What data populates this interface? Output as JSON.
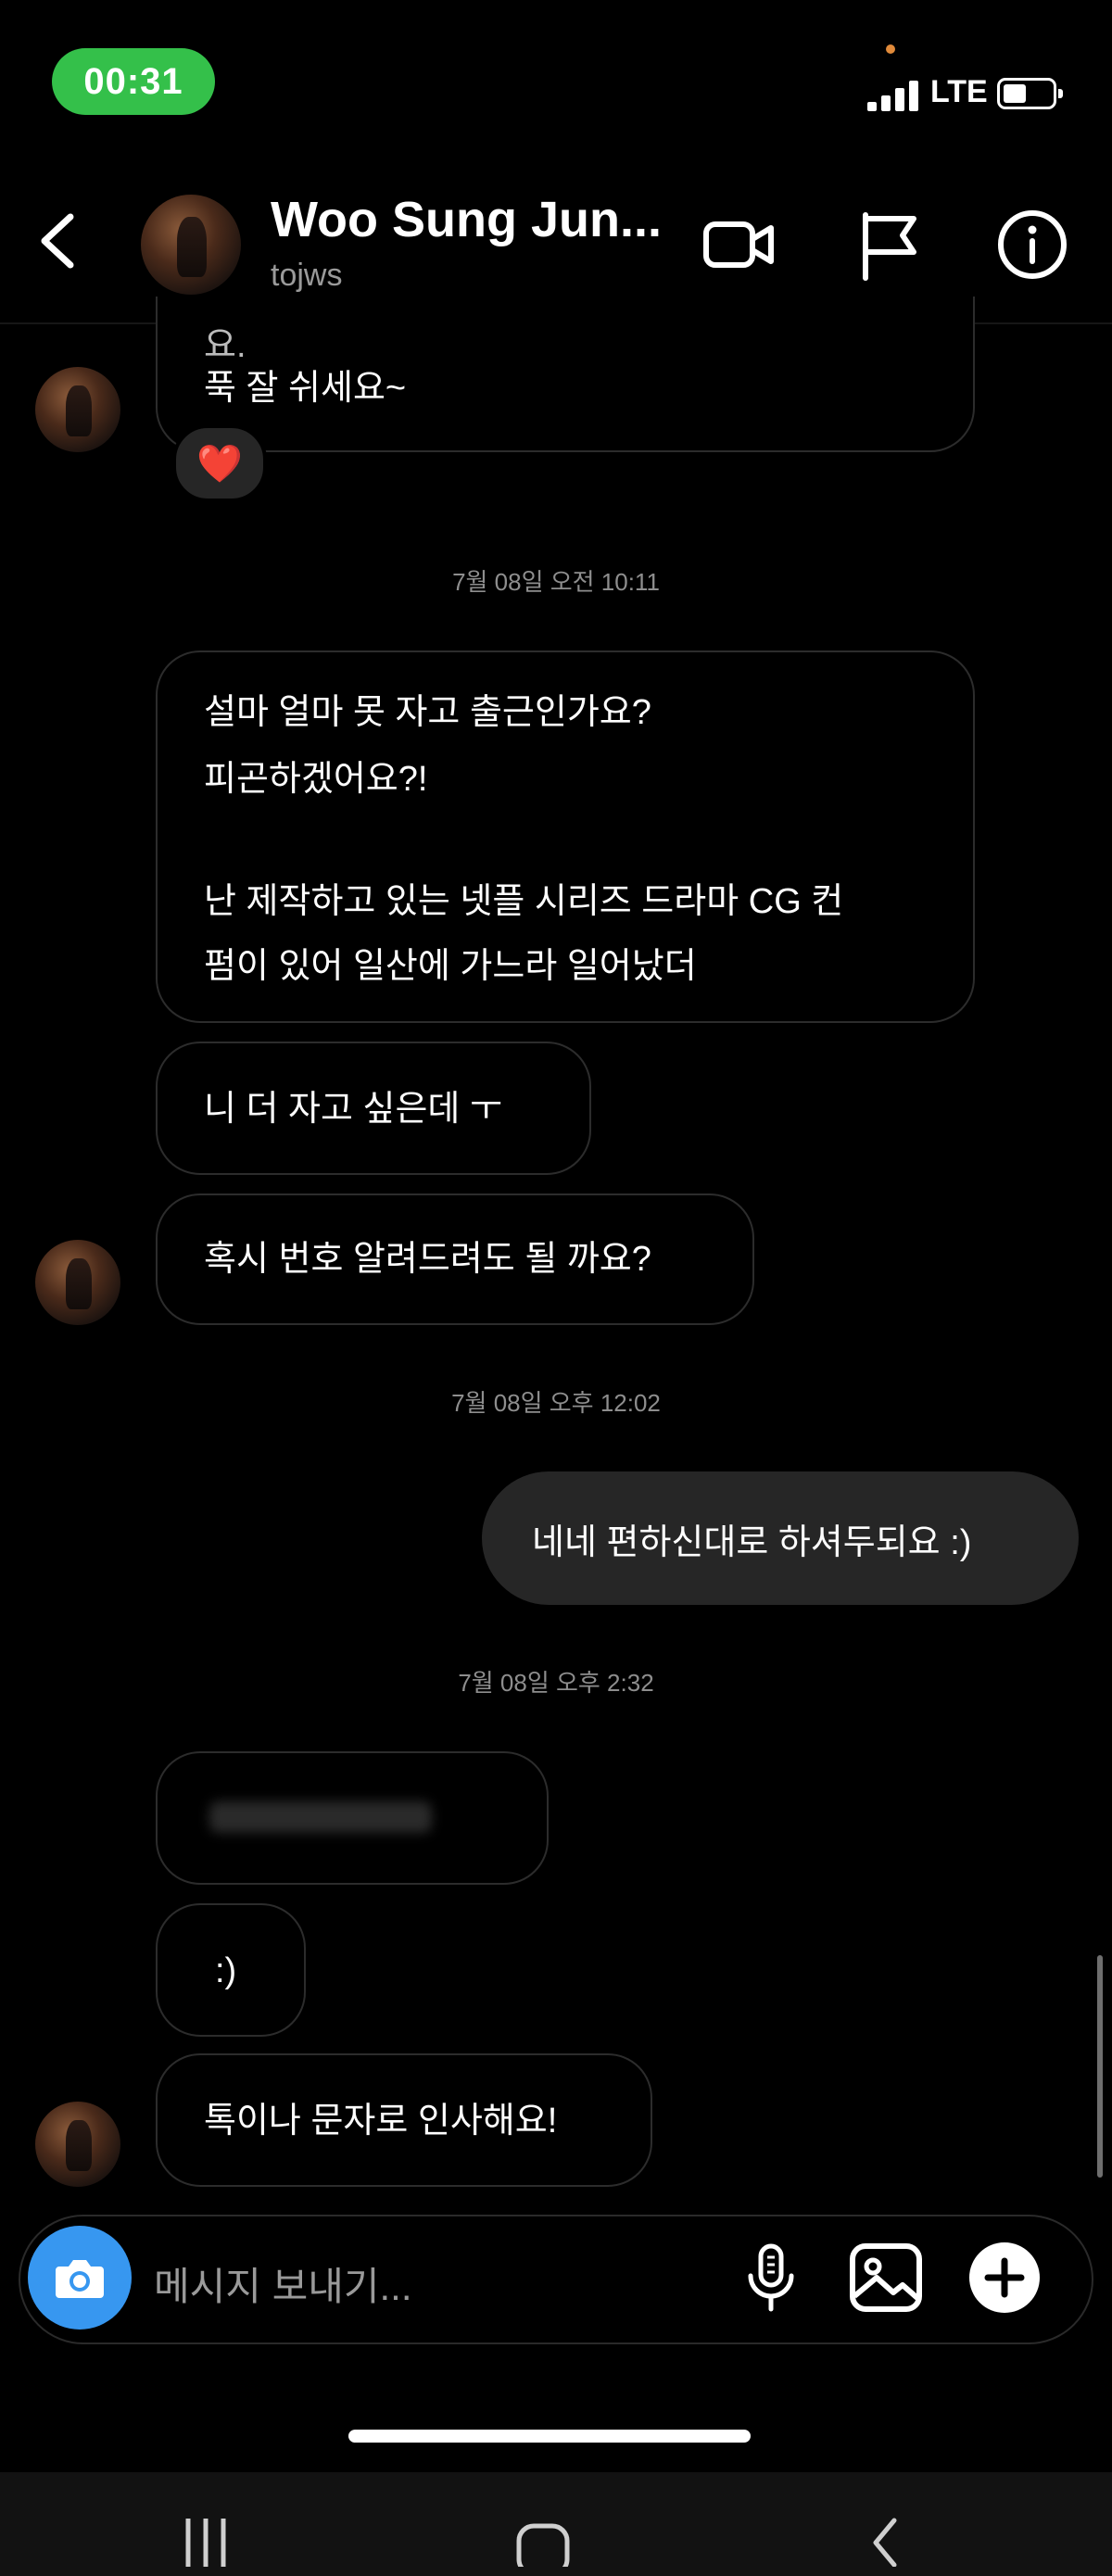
{
  "status_bar": {
    "time": "00:31",
    "network": "LTE",
    "battery_level": 0.4,
    "pill_color": "#34c04a"
  },
  "header": {
    "back_icon": "chevron-left-icon",
    "contact_name": "Woo Sung Jun...",
    "contact_username": "tojws",
    "icons": [
      "video-call-icon",
      "flag-icon",
      "info-icon"
    ]
  },
  "conversation": {
    "top_fragment": {
      "partial_line": "요.",
      "line": "푹 잘 쉬세요~",
      "reaction": "❤️"
    },
    "timestamp_1": "7월 08일 오전 10:11",
    "msg_1": {
      "lines": [
        "설마 얼마 못 자고 출근인가요?",
        "피곤하겠어요?!",
        "",
        "난 제작하고 있는 넷플 시리즈 드라마 CG 컨",
        "펌이 있어 일산에 가느라 일어났더"
      ]
    },
    "msg_2": "니 더 자고 싶은데 ㅜ",
    "msg_3": "혹시 번호 알려드려도 될 까요?",
    "timestamp_2": "7월 08일 오후 12:02",
    "msg_4_outgoing": "네네 편하신대로 하셔두되요 :)",
    "timestamp_3": "7월 08일 오후 2:32",
    "msg_5_blurred": "",
    "msg_6": ":)",
    "msg_7": "톡이나 문자로 인사해요!"
  },
  "composer": {
    "placeholder": "메시지 보내기...",
    "camera_color": "#3797f0",
    "icons": [
      "camera-icon",
      "microphone-icon",
      "gallery-icon",
      "plus-icon"
    ]
  },
  "nav_bar": {
    "buttons": [
      "recent-apps-icon",
      "home-icon",
      "back-icon"
    ]
  }
}
